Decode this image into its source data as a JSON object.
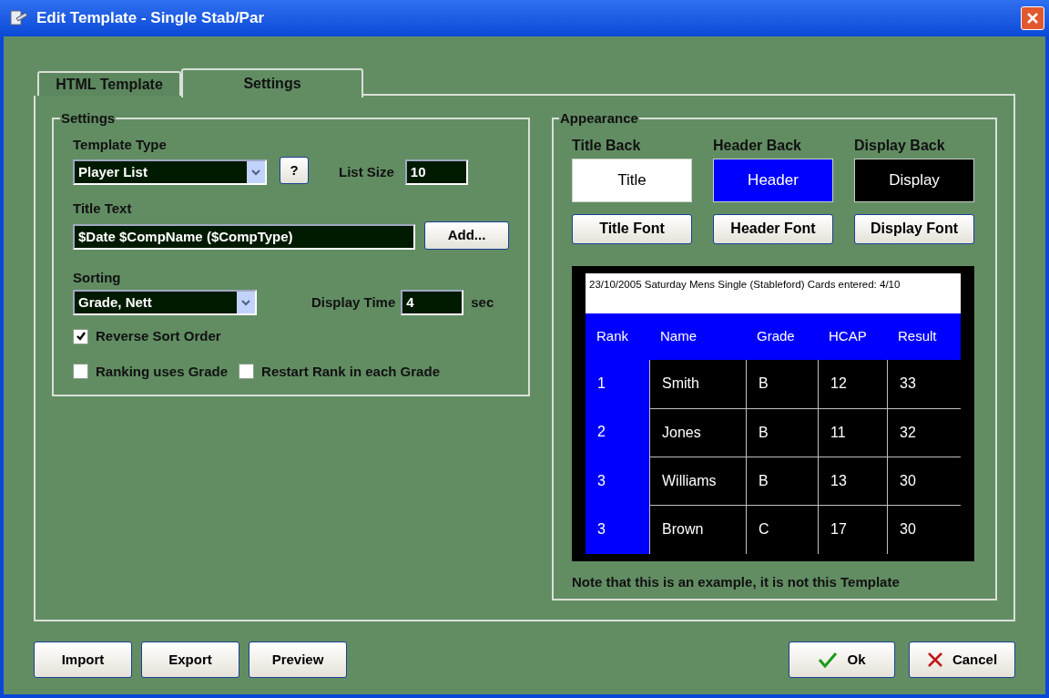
{
  "window": {
    "title": "Edit Template - Single Stab/Par"
  },
  "tabs": [
    {
      "label": "HTML Template",
      "selected": false
    },
    {
      "label": "Settings",
      "selected": true
    }
  ],
  "settings": {
    "title": "Settings",
    "template_type": {
      "label": "Template Type",
      "value": "Player List"
    },
    "help_button": "?",
    "list_size": {
      "label": "List Size",
      "value": "10"
    },
    "title_text": {
      "label": "Title Text",
      "value": "$Date $CompName ($CompType)"
    },
    "add_button": "Add...",
    "sorting": {
      "label": "Sorting",
      "value": "Grade, Nett"
    },
    "display_time": {
      "label": "Display Time",
      "value": "4",
      "unit": "sec"
    },
    "checkboxes": [
      {
        "label": "Reverse Sort Order",
        "checked": true
      },
      {
        "label": "Ranking uses Grade",
        "checked": false
      },
      {
        "label": "Restart Rank in each Grade",
        "checked": false
      }
    ]
  },
  "appearance": {
    "title": "Appearance",
    "swatches": [
      {
        "label": "Title Back",
        "sample": "Title",
        "color": "#ffffff",
        "button": "Title Font"
      },
      {
        "label": "Header Back",
        "sample": "Header",
        "color": "#0000ff",
        "button": "Header Font"
      },
      {
        "label": "Display Back",
        "sample": "Display",
        "color": "#000000",
        "button": "Display Font"
      }
    ],
    "preview": {
      "title_line": "23/10/2005 Saturday Mens Single (Stableford) Cards entered: 4/10",
      "columns": [
        "Rank",
        "Name",
        "Grade",
        "HCAP",
        "Result"
      ],
      "rows": [
        [
          "1",
          "Smith",
          "B",
          "12",
          "33"
        ],
        [
          "2",
          "Jones",
          "B",
          "11",
          "32"
        ],
        [
          "3",
          "Williams",
          "B",
          "13",
          "30"
        ],
        [
          "3",
          "Brown",
          "C",
          "17",
          "30"
        ]
      ]
    },
    "note": "Note that this is an example, it is not this Template"
  },
  "buttons_left": [
    "Import",
    "Export",
    "Preview"
  ],
  "buttons_right": [
    {
      "kind": "ok",
      "label": "Ok"
    },
    {
      "kind": "cancel",
      "label": "Cancel"
    }
  ]
}
